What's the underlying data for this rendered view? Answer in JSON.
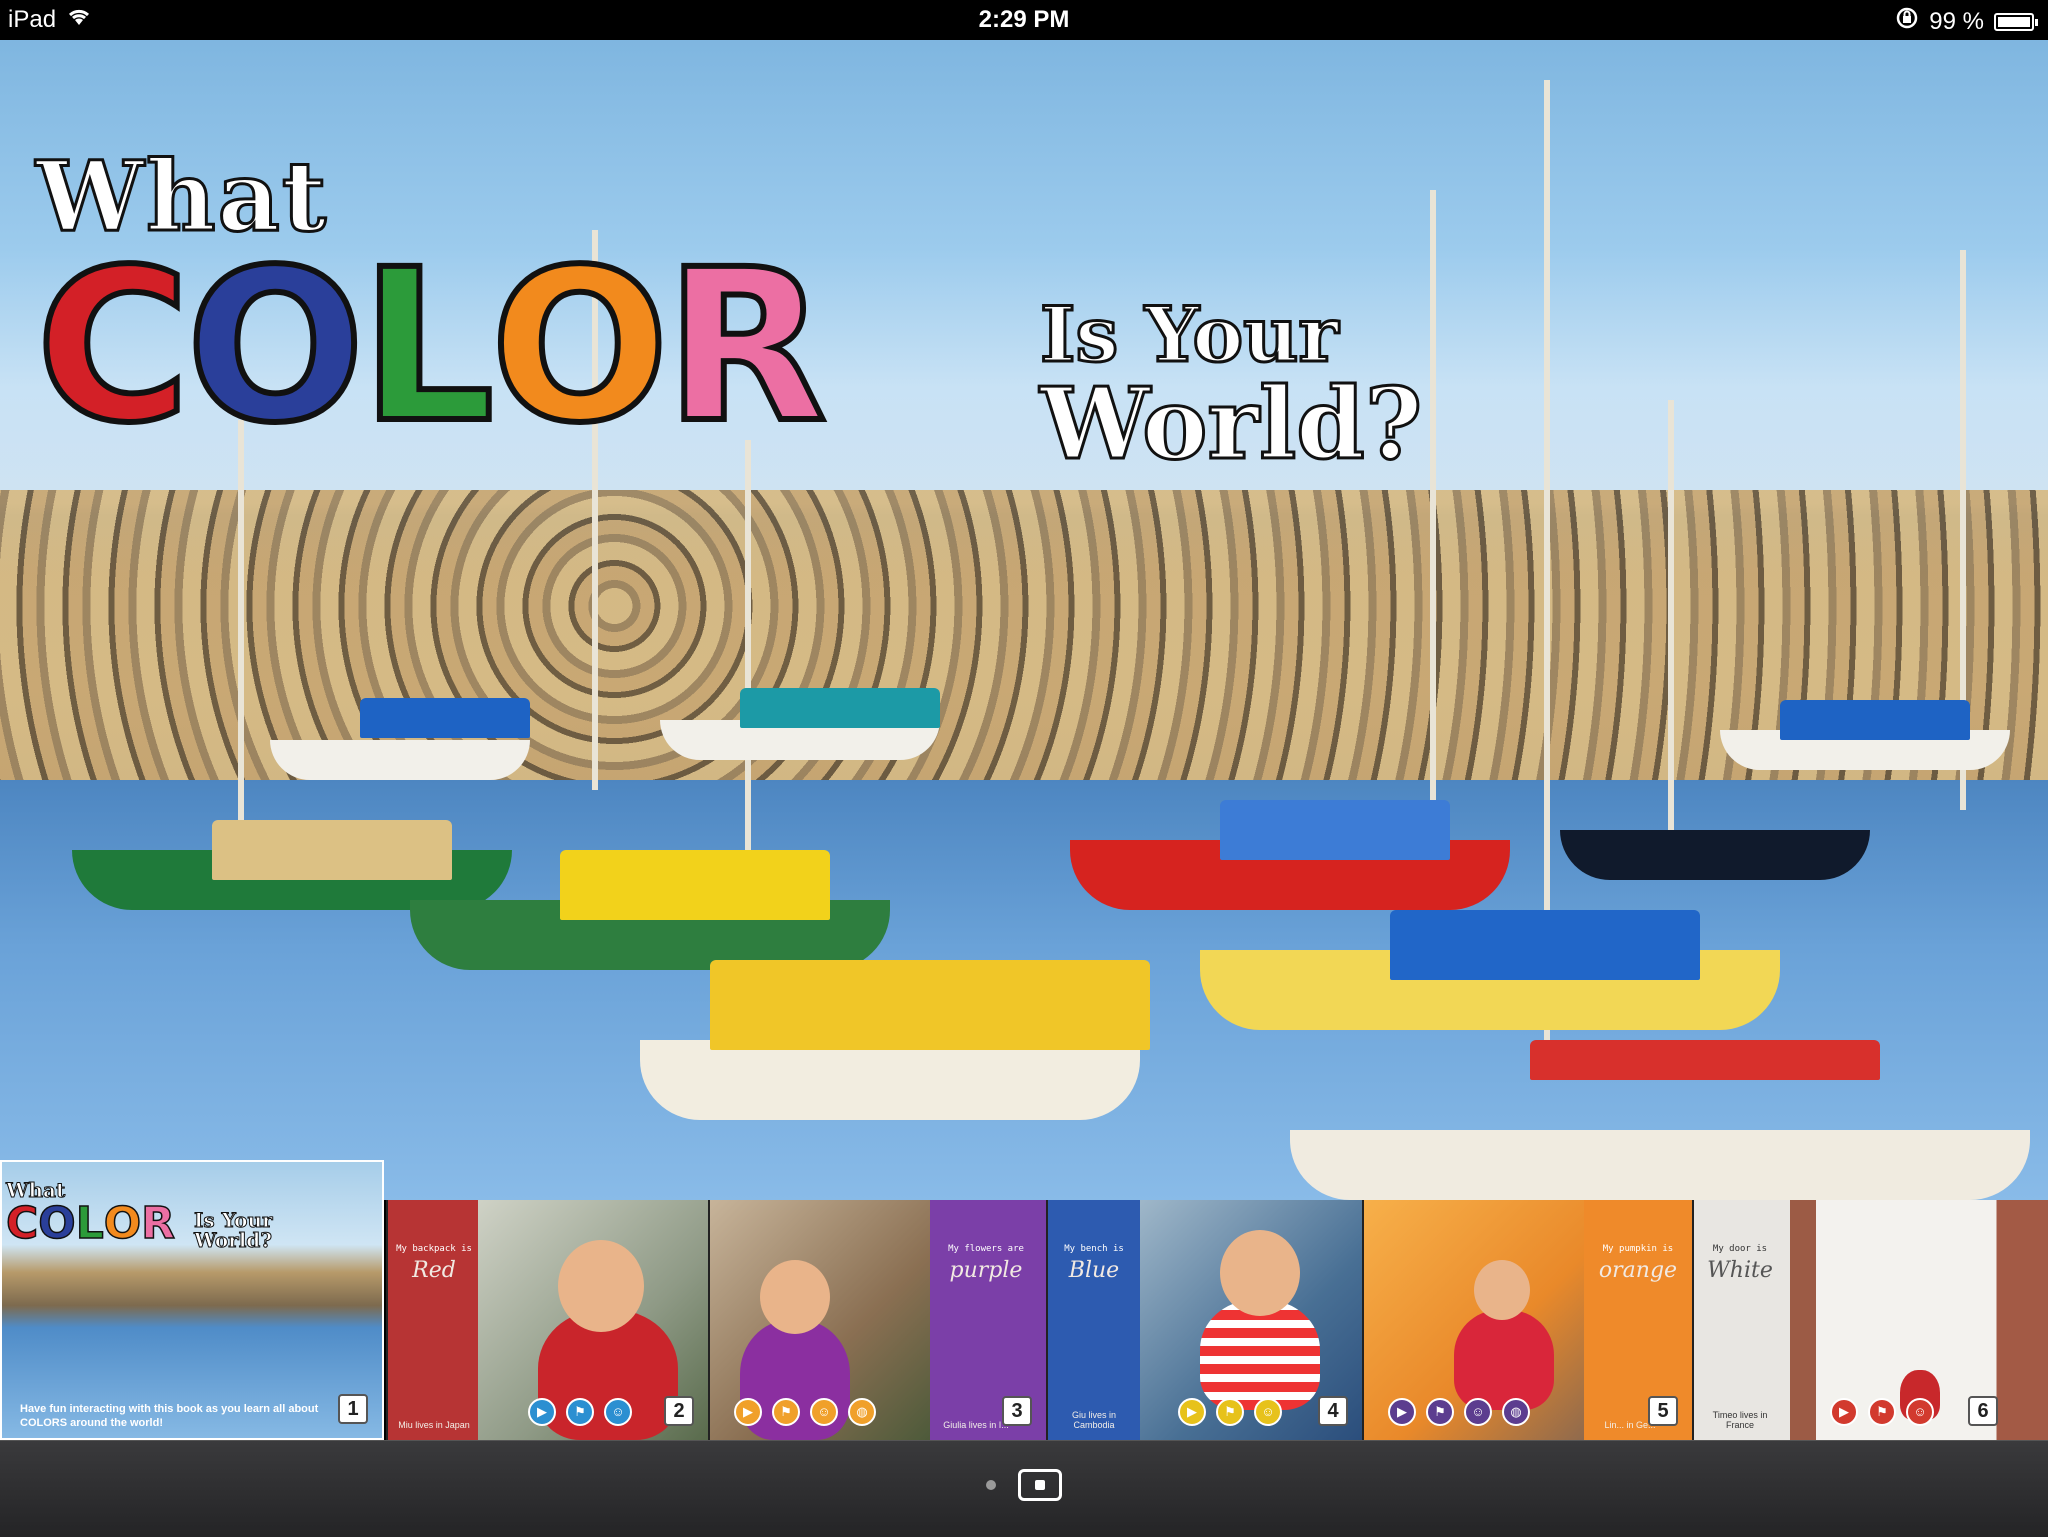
{
  "status_bar": {
    "device": "iPad",
    "time": "2:29 PM",
    "battery": "99 %",
    "battery_level": 0.99,
    "icons": [
      "wifi-icon",
      "rotation-lock-icon",
      "battery-icon"
    ]
  },
  "cover": {
    "title_what": "What",
    "title_color_letters": [
      {
        "letter": "C",
        "color": "#d32027"
      },
      {
        "letter": "O",
        "color": "#2a3f9a"
      },
      {
        "letter": "L",
        "color": "#2c9b3a"
      },
      {
        "letter": "O",
        "color": "#f28a1d"
      },
      {
        "letter": "R",
        "color": "#ec6fa3"
      }
    ],
    "title_is_your": "Is Your",
    "title_world": "World?"
  },
  "thumbnails": [
    {
      "number": "1",
      "title_what": "What",
      "title_color": "COLOR",
      "title_is_your": "Is Your",
      "title_world": "World?",
      "caption": "Have fun interacting with this book as you learn all about COLORS around the world!"
    },
    {
      "number": "2",
      "line1": "My backpack is",
      "color_word": "Red",
      "foot": "Miu lives in Japan",
      "page_color": "#b73434",
      "icons": [
        "play-icon",
        "flag-icon",
        "face-icon"
      ]
    },
    {
      "number": "3",
      "line1": "My flowers are",
      "color_word": "purple",
      "foot": "Giulia lives in I...",
      "page_color": "#7b3fa8",
      "icons": [
        "play-icon",
        "flag-icon",
        "face-icon",
        "globe-icon"
      ]
    },
    {
      "number": "4",
      "line1": "My bench is",
      "color_word": "Blue",
      "foot": "Giu lives in Cambodia",
      "page_color": "#2d5bb0",
      "icons": [
        "play-icon",
        "flag-icon",
        "face-icon"
      ]
    },
    {
      "number": "5",
      "line1": "My pumpkin is",
      "color_word": "orange",
      "foot": "Lin... in Ge...",
      "page_color": "#ef8a2a",
      "icons": [
        "play-icon",
        "flag-icon",
        "face-icon",
        "globe-icon"
      ]
    },
    {
      "number": "6",
      "line1": "My door is",
      "color_word": "White",
      "foot": "Timeo lives in France",
      "page_color": "#e8e6e2",
      "icons": [
        "play-icon",
        "flag-icon",
        "face-icon"
      ]
    }
  ],
  "pager": {
    "pages": 2,
    "current": 2
  }
}
